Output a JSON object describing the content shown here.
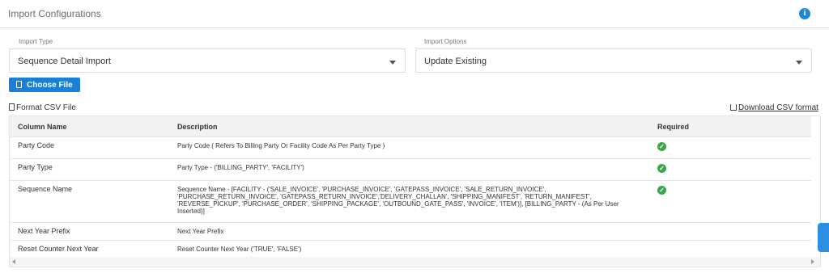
{
  "header": {
    "title": "Import Configurations",
    "info_icon": "i"
  },
  "import_type": {
    "label": "Import Type",
    "value": "Sequence Detail Import"
  },
  "import_options": {
    "label": "Import Options",
    "value": "Update Existing"
  },
  "choose_file_label": "Choose File",
  "format_csv_label": "Format CSV File",
  "download_csv_label": "Download CSV format",
  "table": {
    "columns": [
      "Column Name",
      "Description",
      "Required"
    ],
    "rows": [
      {
        "name": "Party Code",
        "description": "Party Code ( Refers To Billing Party Or Facility Code As Per Party Type )",
        "required": true
      },
      {
        "name": "Party Type",
        "description": "Party Type - ('BILLING_PARTY', 'FACILITY')",
        "required": true
      },
      {
        "name": "Sequence Name",
        "description": "Sequence Name - [FACILITY - ('SALE_INVOICE', 'PURCHASE_INVOICE', 'GATEPASS_INVOICE', 'SALE_RETURN_INVOICE', 'PURCHASE_RETURN_INVOICE', 'GATEPASS_RETURN_INVOICE','DELIVERY_CHALLAN', 'SHIPPING_MANIFEST', 'RETURN_MANIFEST', 'REVERSE_PICKUP', 'PURCHASE_ORDER', 'SHIPPING_PACKAGE', 'OUTBOUND_GATE_PASS', 'INVOICE', 'ITEM')], [BILLING_PARTY - (As Per User Inserted)]",
        "required": true
      },
      {
        "name": "Next Year Prefix",
        "description": "Next Year Prefix",
        "required": false
      },
      {
        "name": "Reset Counter Next Year",
        "description": "Reset Counter Next Year ('TRUE', 'FALSE')",
        "required": false
      }
    ]
  },
  "colors": {
    "accent": "#1a7fd6",
    "check": "#3aa64a",
    "header_bg": "#f2f2f2"
  },
  "icons": {
    "info": "info-icon",
    "file": "file-icon",
    "document": "document-icon",
    "download": "download-icon",
    "check": "check-circle-icon"
  }
}
